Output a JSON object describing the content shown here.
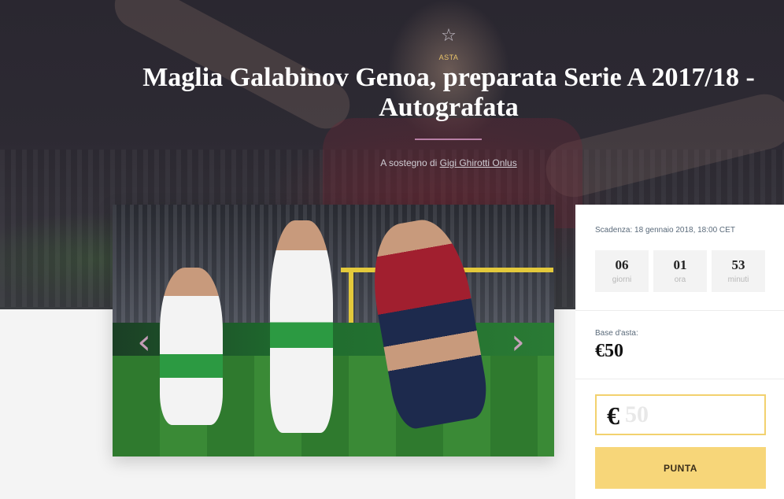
{
  "hero": {
    "label": "ASTA",
    "title": "Maglia Galabinov Genoa, preparata Serie A 2017/18 - Autografata",
    "support_prefix": "A sostegno di",
    "support_link": "Gigi Ghirotti Onlus",
    "star_icon": "star-icon"
  },
  "gallery": {
    "prev_icon": "‹",
    "next_icon": "›"
  },
  "auction": {
    "deadline_label": "Scadenza:",
    "deadline_value": "18 gennaio 2018, 18:00 CET",
    "countdown": [
      {
        "value": "06",
        "unit": "giorni"
      },
      {
        "value": "01",
        "unit": "ora"
      },
      {
        "value": "53",
        "unit": "minuti"
      }
    ],
    "base_label": "Base d'asta:",
    "base_value": "€50",
    "bid_currency": "€",
    "bid_placeholder": "50",
    "bid_button": "PUNTA"
  },
  "colors": {
    "accent_yellow": "#f7d679",
    "accent_border": "#f2d16e",
    "title_rule": "#b77fa5",
    "label_gold": "#e9c46a"
  }
}
